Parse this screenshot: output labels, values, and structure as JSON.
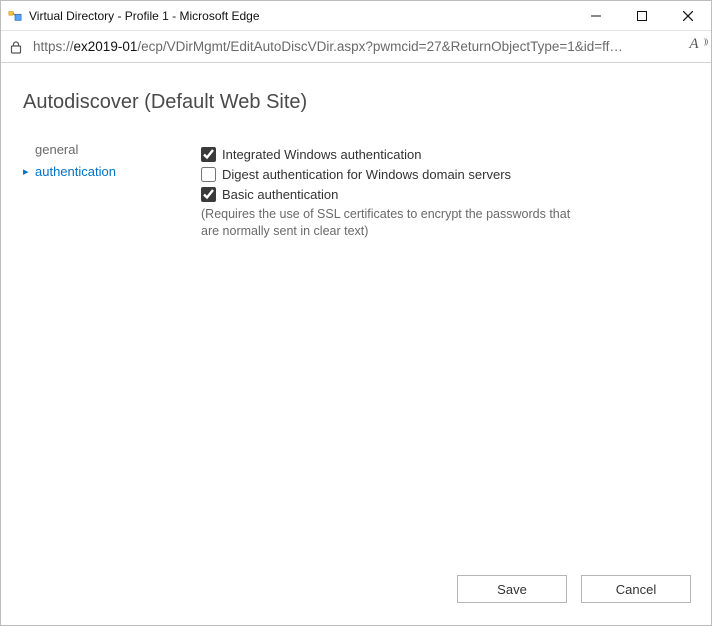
{
  "window": {
    "title": "Virtual Directory - Profile 1 - Microsoft Edge"
  },
  "address": {
    "protocol": "https://",
    "host": "ex2019-01",
    "path": "/ecp/VDirMgmt/EditAutoDiscVDir.aspx?pwmcid=27&ReturnObjectType=1&id=ff…"
  },
  "page": {
    "title": "Autodiscover (Default Web Site)"
  },
  "sidenav": {
    "items": [
      {
        "label": "general",
        "active": false
      },
      {
        "label": "authentication",
        "active": true
      }
    ]
  },
  "auth": {
    "integrated": {
      "label": "Integrated Windows authentication",
      "checked": true
    },
    "digest": {
      "label": "Digest authentication for Windows domain servers",
      "checked": false
    },
    "basic": {
      "label": "Basic authentication",
      "checked": true
    },
    "basic_hint": "(Requires the use of SSL certificates to encrypt the passwords that are normally sent in clear text)"
  },
  "footer": {
    "save": "Save",
    "cancel": "Cancel"
  }
}
